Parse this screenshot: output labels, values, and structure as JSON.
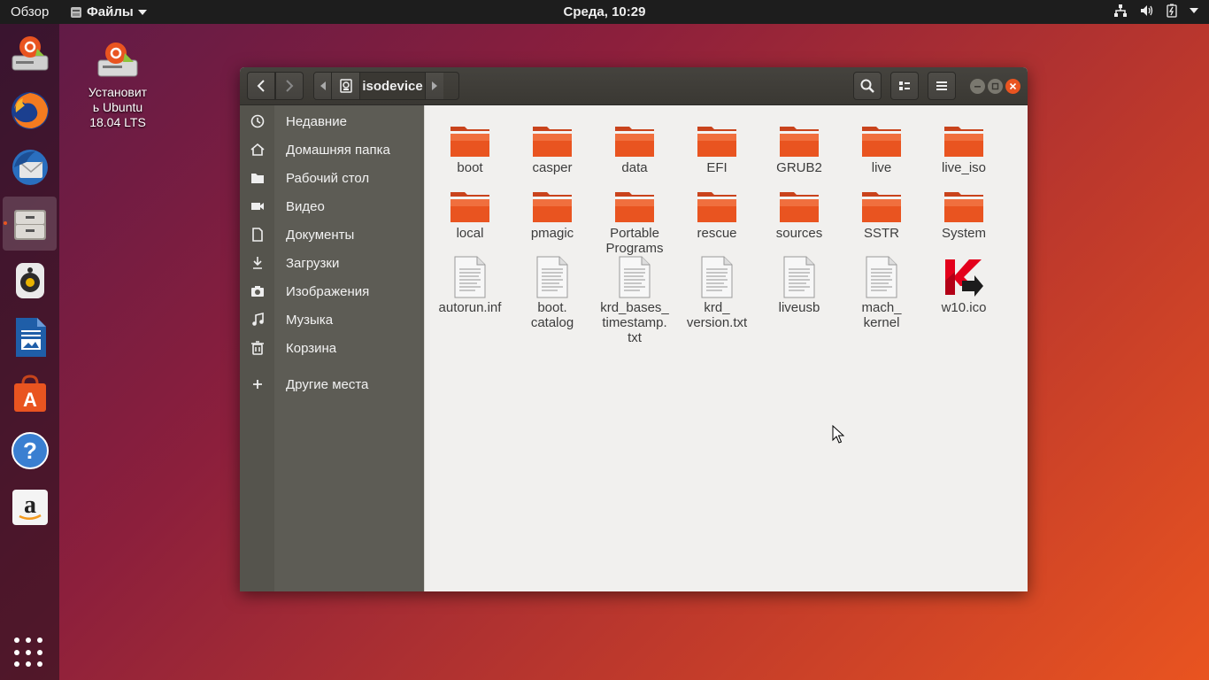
{
  "topbar": {
    "activities": "Обзор",
    "app_menu": "Файлы",
    "clock": "Среда, 10:29"
  },
  "dock": {
    "items": [
      "installer-icon",
      "firefox-icon",
      "thunderbird-icon",
      "files-icon",
      "rhythmbox-icon",
      "writer-icon",
      "software-icon",
      "help-icon",
      "amazon-icon"
    ],
    "active": "files-icon"
  },
  "desktop": {
    "installer_label": "Установить Ubuntu 18.04 LTS",
    "installer_lines": [
      "Установит",
      "ь Ubuntu",
      "18.04 LTS"
    ]
  },
  "window": {
    "path_current": "isodevice",
    "sidebar": [
      {
        "label": "Недавние",
        "icon": "clock-icon"
      },
      {
        "label": "Домашняя папка",
        "icon": "home-icon"
      },
      {
        "label": "Рабочий стол",
        "icon": "folder-icon"
      },
      {
        "label": "Видео",
        "icon": "video-icon"
      },
      {
        "label": "Документы",
        "icon": "document-icon"
      },
      {
        "label": "Загрузки",
        "icon": "download-icon"
      },
      {
        "label": "Изображения",
        "icon": "camera-icon"
      },
      {
        "label": "Музыка",
        "icon": "music-icon"
      },
      {
        "label": "Корзина",
        "icon": "trash-icon"
      },
      {
        "label": "Другие места",
        "icon": "plus-icon"
      }
    ],
    "files": [
      {
        "name": "boot",
        "type": "folder"
      },
      {
        "name": "casper",
        "type": "folder"
      },
      {
        "name": "data",
        "type": "folder"
      },
      {
        "name": "EFI",
        "type": "folder"
      },
      {
        "name": "GRUB2",
        "type": "folder"
      },
      {
        "name": "live",
        "type": "folder"
      },
      {
        "name": "live_iso",
        "type": "folder"
      },
      {
        "name": "local",
        "type": "folder"
      },
      {
        "name": "pmagic",
        "type": "folder"
      },
      {
        "name": "Portable Programs",
        "lines": [
          "Portable",
          "Programs"
        ],
        "type": "folder"
      },
      {
        "name": "rescue",
        "type": "folder"
      },
      {
        "name": "sources",
        "type": "folder"
      },
      {
        "name": "SSTR",
        "type": "folder"
      },
      {
        "name": "System",
        "type": "folder"
      },
      {
        "name": "autorun.inf",
        "type": "text"
      },
      {
        "name": "boot.catalog",
        "lines": [
          "boot.",
          "catalog"
        ],
        "type": "text"
      },
      {
        "name": "krd_bases_timestamp.txt",
        "lines": [
          "krd_bases_",
          "timestamp.",
          "txt"
        ],
        "type": "text"
      },
      {
        "name": "krd_version.txt",
        "lines": [
          "krd_",
          "version.txt"
        ],
        "type": "text"
      },
      {
        "name": "liveusb",
        "type": "text"
      },
      {
        "name": "mach_kernel",
        "lines": [
          "mach_",
          "kernel"
        ],
        "type": "text"
      },
      {
        "name": "w10.ico",
        "type": "kaspersky"
      }
    ]
  },
  "colors": {
    "ubuntu_orange": "#e95420",
    "folder_top": "#f08050",
    "folder_body": "#e4572e",
    "headerbar": "#3c3b37",
    "sidebar": "#5d5c55"
  }
}
